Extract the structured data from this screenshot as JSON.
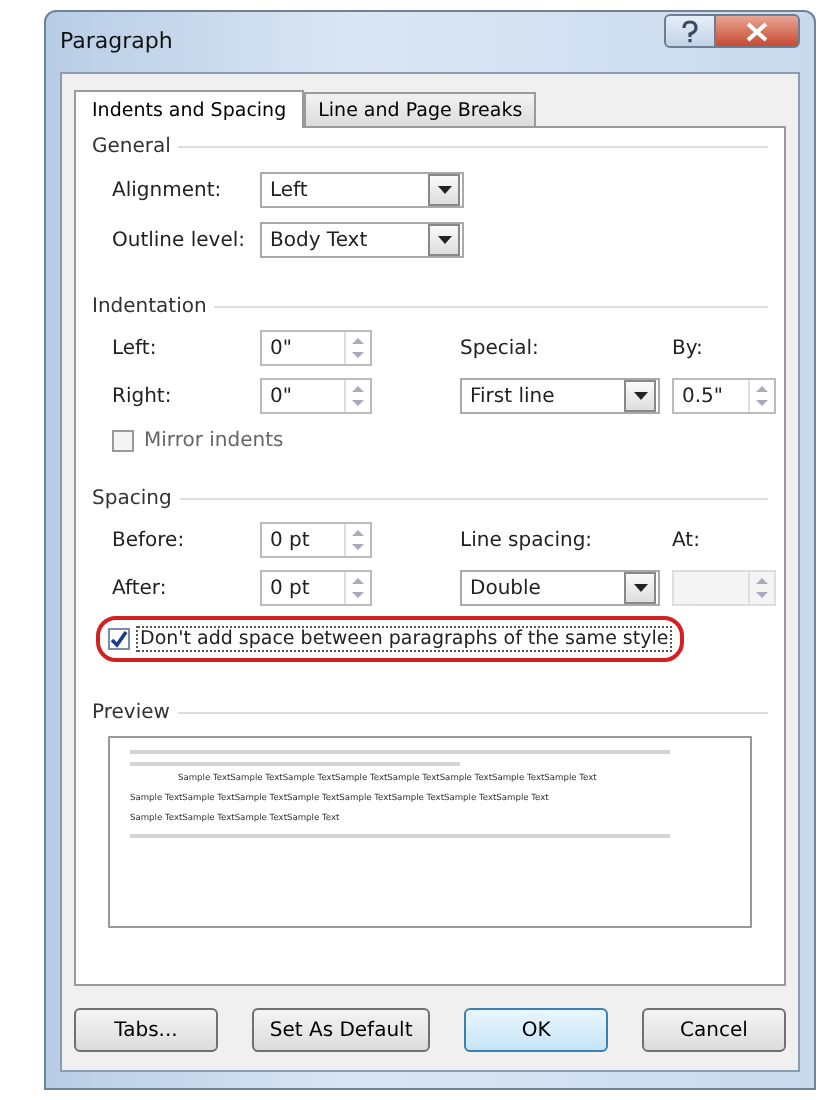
{
  "window": {
    "title": "Paragraph"
  },
  "tabs": [
    {
      "label": "Indents and Spacing",
      "selected": true
    },
    {
      "label": "Line and Page Breaks",
      "selected": false
    }
  ],
  "general": {
    "title": "General",
    "fields": [
      {
        "label": "Alignment:",
        "value": "Left"
      },
      {
        "label": "Outline level:",
        "value": "Body Text"
      }
    ]
  },
  "indentation": {
    "title": "Indentation",
    "left": {
      "label": "Left:",
      "value": "0\""
    },
    "right": {
      "label": "Right:",
      "value": "0\""
    },
    "special": {
      "label": "Special:",
      "value": "First line"
    },
    "by": {
      "label": "By:",
      "value": "0.5\""
    },
    "mirror": {
      "label": "Mirror indents",
      "checked": false
    }
  },
  "spacing": {
    "title": "Spacing",
    "before": {
      "label": "Before:",
      "value": "0 pt"
    },
    "after": {
      "label": "After:",
      "value": "0 pt"
    },
    "line_spacing": {
      "label": "Line spacing:",
      "value": "Double"
    },
    "at": {
      "label": "At:",
      "disabled": true
    },
    "dont_add": {
      "label": "Don't add space between paragraphs of the same style",
      "checked": true,
      "circled": true
    }
  },
  "preview": {
    "title": "Preview",
    "sample_lines": [
      "Sample TextSample TextSample TextSample TextSample TextSample TextSample TextSample Text",
      "Sample TextSample TextSample TextSample TextSample TextSample TextSample TextSample Text",
      "Sample TextSample TextSample TextSample Text"
    ]
  },
  "buttons": [
    {
      "label": "Tabs...",
      "default": false
    },
    {
      "label": "Set As Default",
      "default": false
    },
    {
      "label": "OK",
      "default": true
    },
    {
      "label": "Cancel",
      "default": false
    }
  ]
}
